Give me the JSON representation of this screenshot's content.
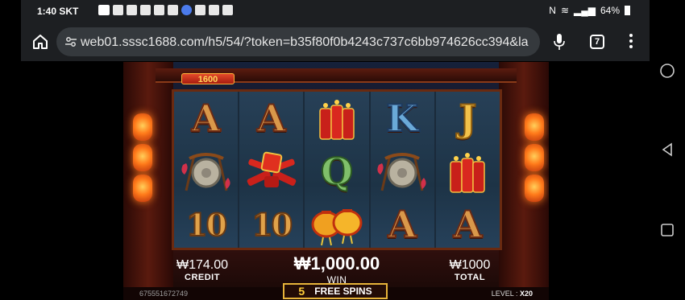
{
  "status_bar": {
    "time": "1:40",
    "carrier": "SKT",
    "battery": "64%"
  },
  "browser": {
    "url": "web01.sssc1688.com/h5/54/?token=b35f80f0b4243c737c6bb974626cc394&la",
    "tab_count": "7"
  },
  "game": {
    "jackpot_value": "1600",
    "reels": [
      [
        "A",
        "gong",
        "10"
      ],
      [
        "A",
        "firecracker-bundle",
        "10"
      ],
      [
        "firecrackers",
        "Q",
        "lanterns"
      ],
      [
        "K",
        "gong",
        "A"
      ],
      [
        "J",
        "firecrackers",
        "A"
      ]
    ],
    "credit": {
      "value": "₩174.00",
      "label": "CREDIT"
    },
    "win": {
      "value": "₩1,000.00",
      "label": "WIN"
    },
    "total": {
      "value": "₩1000",
      "label": "TOTAL"
    },
    "game_id": "675551672749",
    "free_spins": {
      "count": "5",
      "label": "FREE SPINS"
    },
    "level": {
      "label": "LEVEL :",
      "value": "X20"
    }
  }
}
